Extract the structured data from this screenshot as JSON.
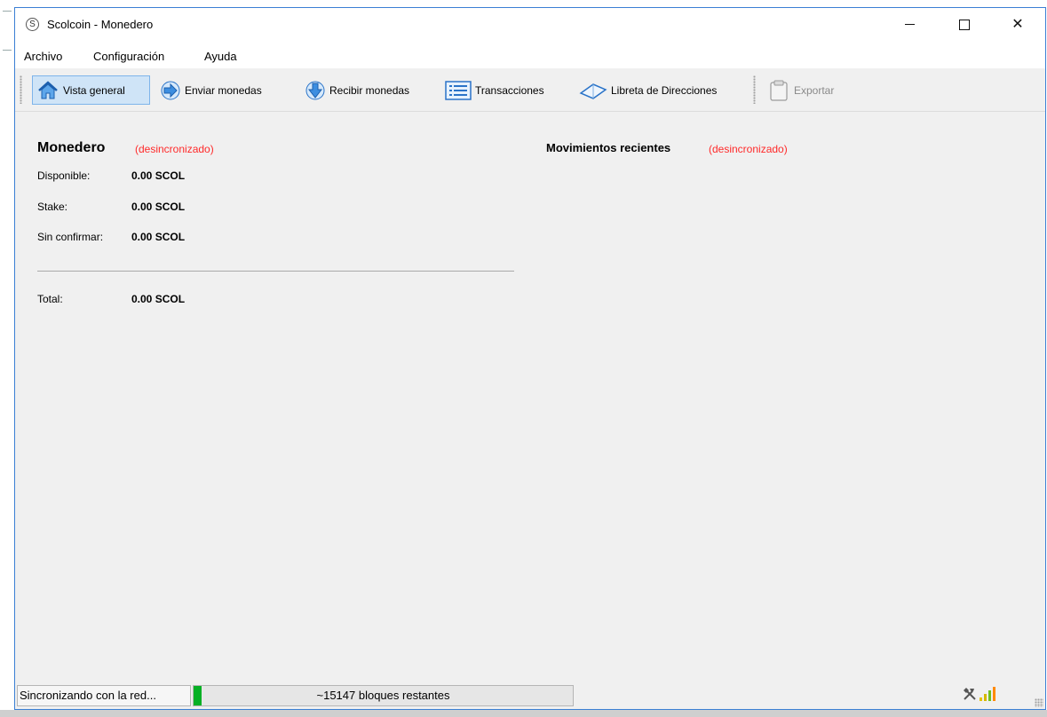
{
  "window": {
    "title": "Scolcoin - Monedero",
    "app_icon_glyph": "S",
    "minimize_icon": "minimize-icon",
    "maximize_icon": "maximize-icon",
    "close_icon": "close-icon",
    "close_glyph": "✕"
  },
  "menu": {
    "items": [
      "Archivo",
      "Configuración",
      "Ayuda"
    ]
  },
  "toolbar": {
    "buttons": [
      {
        "label": "Vista general",
        "icon": "home-icon",
        "active": true
      },
      {
        "label": "Enviar monedas",
        "icon": "arrow-right-icon",
        "active": false
      },
      {
        "label": "Recibir monedas",
        "icon": "arrow-down-icon",
        "active": false
      },
      {
        "label": "Transacciones",
        "icon": "list-icon",
        "active": false
      },
      {
        "label": "Libreta de Direcciones",
        "icon": "address-book-icon",
        "active": false
      },
      {
        "label": "Exportar",
        "icon": "clipboard-icon",
        "active": false,
        "disabled": true
      }
    ]
  },
  "wallet": {
    "title": "Monedero",
    "status": "(desincronizado)",
    "rows": [
      {
        "label": "Disponible:",
        "value": "0.00 SCOL"
      },
      {
        "label": "Stake:",
        "value": "0.00 SCOL"
      },
      {
        "label": "Sin confirmar:",
        "value": "0.00 SCOL"
      }
    ],
    "total": {
      "label": "Total:",
      "value": "0.00 SCOL"
    }
  },
  "recent": {
    "title": "Movimientos recientes",
    "status": "(desincronizado)"
  },
  "statusbar": {
    "text": "Sincronizando con la red...",
    "progress_text": "~15147 bloques restantes",
    "progress_fraction": 0.004,
    "icons": [
      "staking-icon",
      "signal-bars-icon"
    ]
  },
  "colors": {
    "accent": "#3b7fd4",
    "unsync_red": "#ff2a2a",
    "progress_green": "#06b025",
    "active_button": "#cfe4f7"
  }
}
